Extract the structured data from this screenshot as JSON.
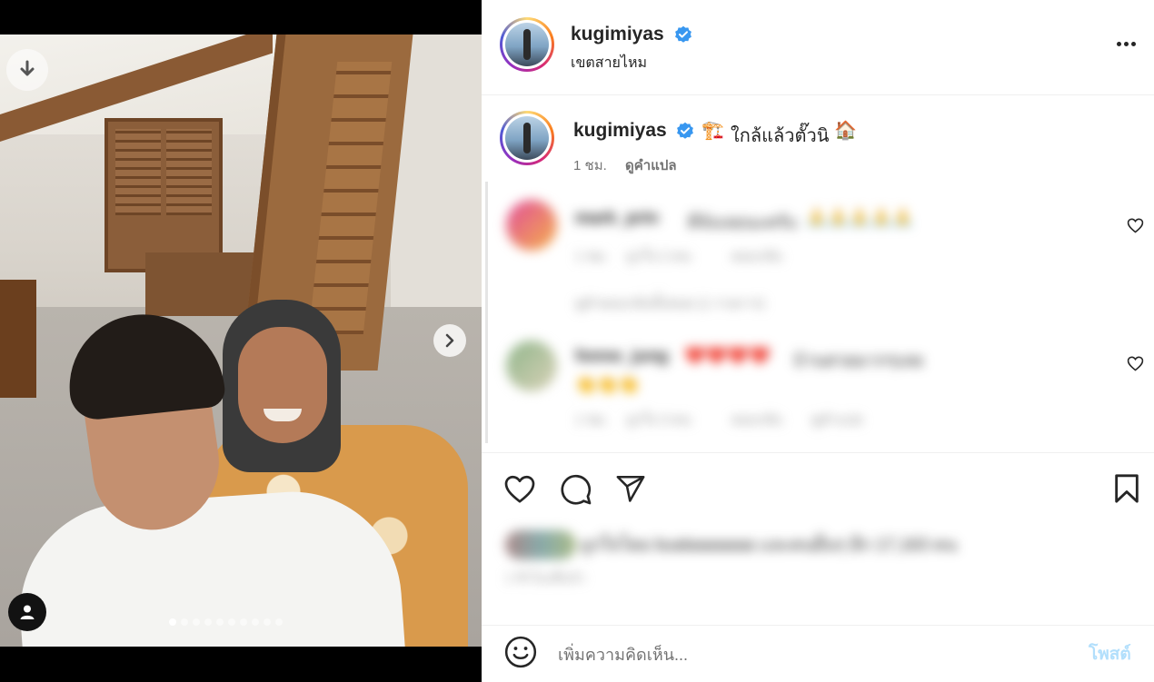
{
  "post": {
    "username": "kugimiyas",
    "verified": true,
    "location": "เขตสายไหม",
    "carousel": {
      "total_slides": 10,
      "active_slide": 1
    }
  },
  "caption": {
    "username": "kugimiyas",
    "emoji_before": "🏗️",
    "text": "ใกล้แล้วตั๊วนิ",
    "emoji_after": "🏠",
    "time": "1 ชม.",
    "translate_label": "ดูคำแปล"
  },
  "comments": [
    {
      "username": "mark_prin",
      "text": "ดีจังเลยนะครับ",
      "emojis": "🙏🙏🙏🙏🙏",
      "time": "1 ชม.",
      "likes": "ถูกใจ 2 คน",
      "reply": "ตอบกลับ",
      "view_replies": "ดูคำตอบกลับทั้งหมด (1 รายการ)"
    },
    {
      "username": "fonne_jung",
      "emojis": "❤️❤️❤️❤️",
      "text": "บ้านสวยมากๆเลย",
      "emojis_line2": "👏👏👏",
      "time": "1 ชม.",
      "likes": "ถูกใจ 3 คน",
      "reply": "ตอบกลับ",
      "see_translation": "ดูคำแปล"
    }
  ],
  "likes_summary": "ถูกใจโดย bualaaaaaaa และคนอื่นๆ อีก 17,163 คน",
  "likes_date": "1 ชั่วโมงที่แล้ว",
  "comment_box": {
    "placeholder": "เพิ่มความคิดเห็น...",
    "post_label": "โพสต์"
  },
  "colors": {
    "verified_blue": "#3897f0",
    "post_button_disabled": "#b2dffc",
    "text_primary": "#262626",
    "text_secondary": "#737373"
  },
  "icons": [
    "download-icon",
    "chevron-right-icon",
    "user-tag-icon",
    "more-horizontal-icon",
    "verified-badge-icon",
    "heart-icon",
    "comment-icon",
    "share-icon",
    "bookmark-icon",
    "emoji-icon"
  ]
}
